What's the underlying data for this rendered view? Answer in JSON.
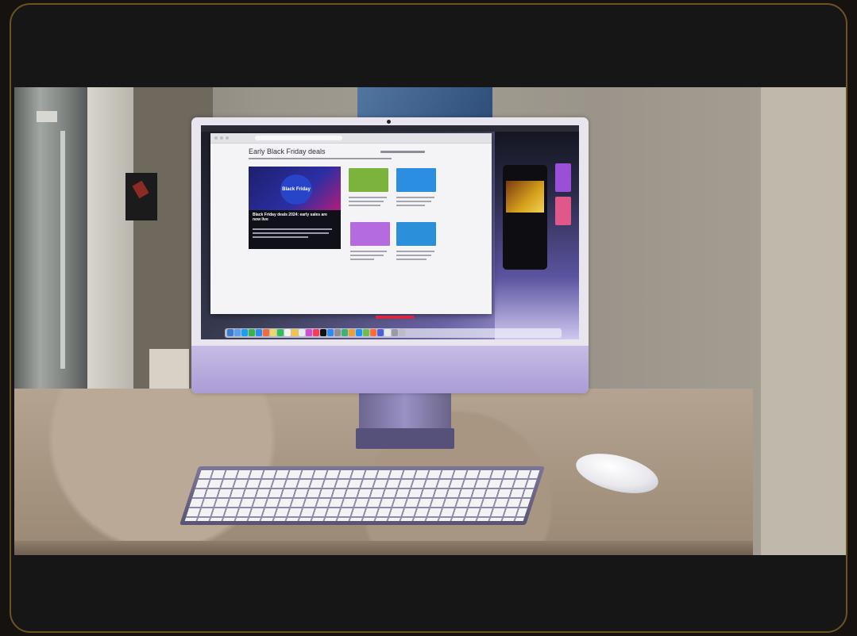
{
  "screen": {
    "page_title": "Early Black Friday deals",
    "hero_badge": "Black Friday",
    "hero_headline": "Black Friday deals 2024: early sales are now live"
  },
  "colors": {
    "frame_border": "#6e5224",
    "imac_body": "#e9e5ef",
    "imac_chin": "#b7aadf",
    "keyboard_frame": "#6b6487",
    "hero_background": "#101019"
  },
  "objects": [
    "imac-computer",
    "magic-keyboard",
    "magic-mouse",
    "granite-countertop",
    "refrigerator",
    "wall-art"
  ]
}
